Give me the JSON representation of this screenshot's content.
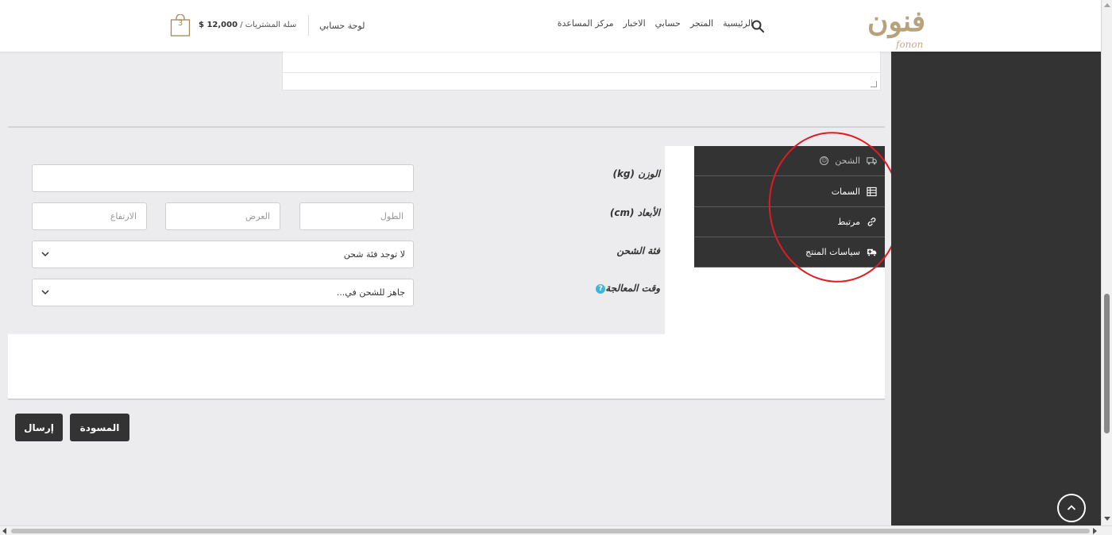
{
  "header": {
    "logo_text": "فنون",
    "logo_latin": "fonon",
    "nav": [
      "الرئيسية",
      "المتجر",
      "حسابي",
      "الاخبار",
      "مركز المساعدة"
    ],
    "dashboard": "لوحة حسابي",
    "cart_label": "سلة المشتريات /",
    "cart_total": "$ 12,000",
    "cart_count": "3"
  },
  "shipping_form": {
    "weight_label": "الوزن (kg)",
    "dimensions_label": "الأبعاد (cm)",
    "length_placeholder": "الطول",
    "width_placeholder": "العرض",
    "height_placeholder": "الارتفاع",
    "shipping_class_label": "فئة الشحن",
    "shipping_class_value": "لا توجد فئة شحن",
    "processing_time_label": "وقت المعالجة",
    "processing_time_value": "جاهز للشحن في..."
  },
  "tabs": [
    {
      "label": "الشحن",
      "icon": "truck-icon",
      "active": true
    },
    {
      "label": "السمات",
      "icon": "list-icon",
      "active": false
    },
    {
      "label": "مرتبط",
      "icon": "link-icon",
      "active": false
    },
    {
      "label": "سياسات المنتج",
      "icon": "ambulance-icon",
      "active": false
    }
  ],
  "buttons": {
    "submit": "إرسال",
    "draft": "المسودة"
  },
  "colors": {
    "accent": "#b8a27d",
    "dark": "#333333",
    "annotation": "#e01b24",
    "info": "#3fb7d8"
  }
}
